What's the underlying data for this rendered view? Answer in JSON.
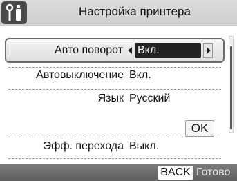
{
  "header": {
    "title": "Настройка принтера",
    "icon": "settings-tools-icon"
  },
  "settings": [
    {
      "label": "Авто поворот",
      "value": "Вкл.",
      "selected": true
    },
    {
      "label": "Автовыключение",
      "value": "Вкл."
    },
    {
      "label": "Язык",
      "value": "Русский"
    },
    {
      "label": "Эфф. перехода",
      "value": "Выкл."
    }
  ],
  "ok_label": "OK",
  "footer": {
    "back_label": "BACK",
    "status_label": "Готово"
  },
  "colors": {
    "selected_value_bg": "#232323",
    "footer_bg": "#6a6a6a",
    "title_bar_bg": "#d6d6d6"
  }
}
